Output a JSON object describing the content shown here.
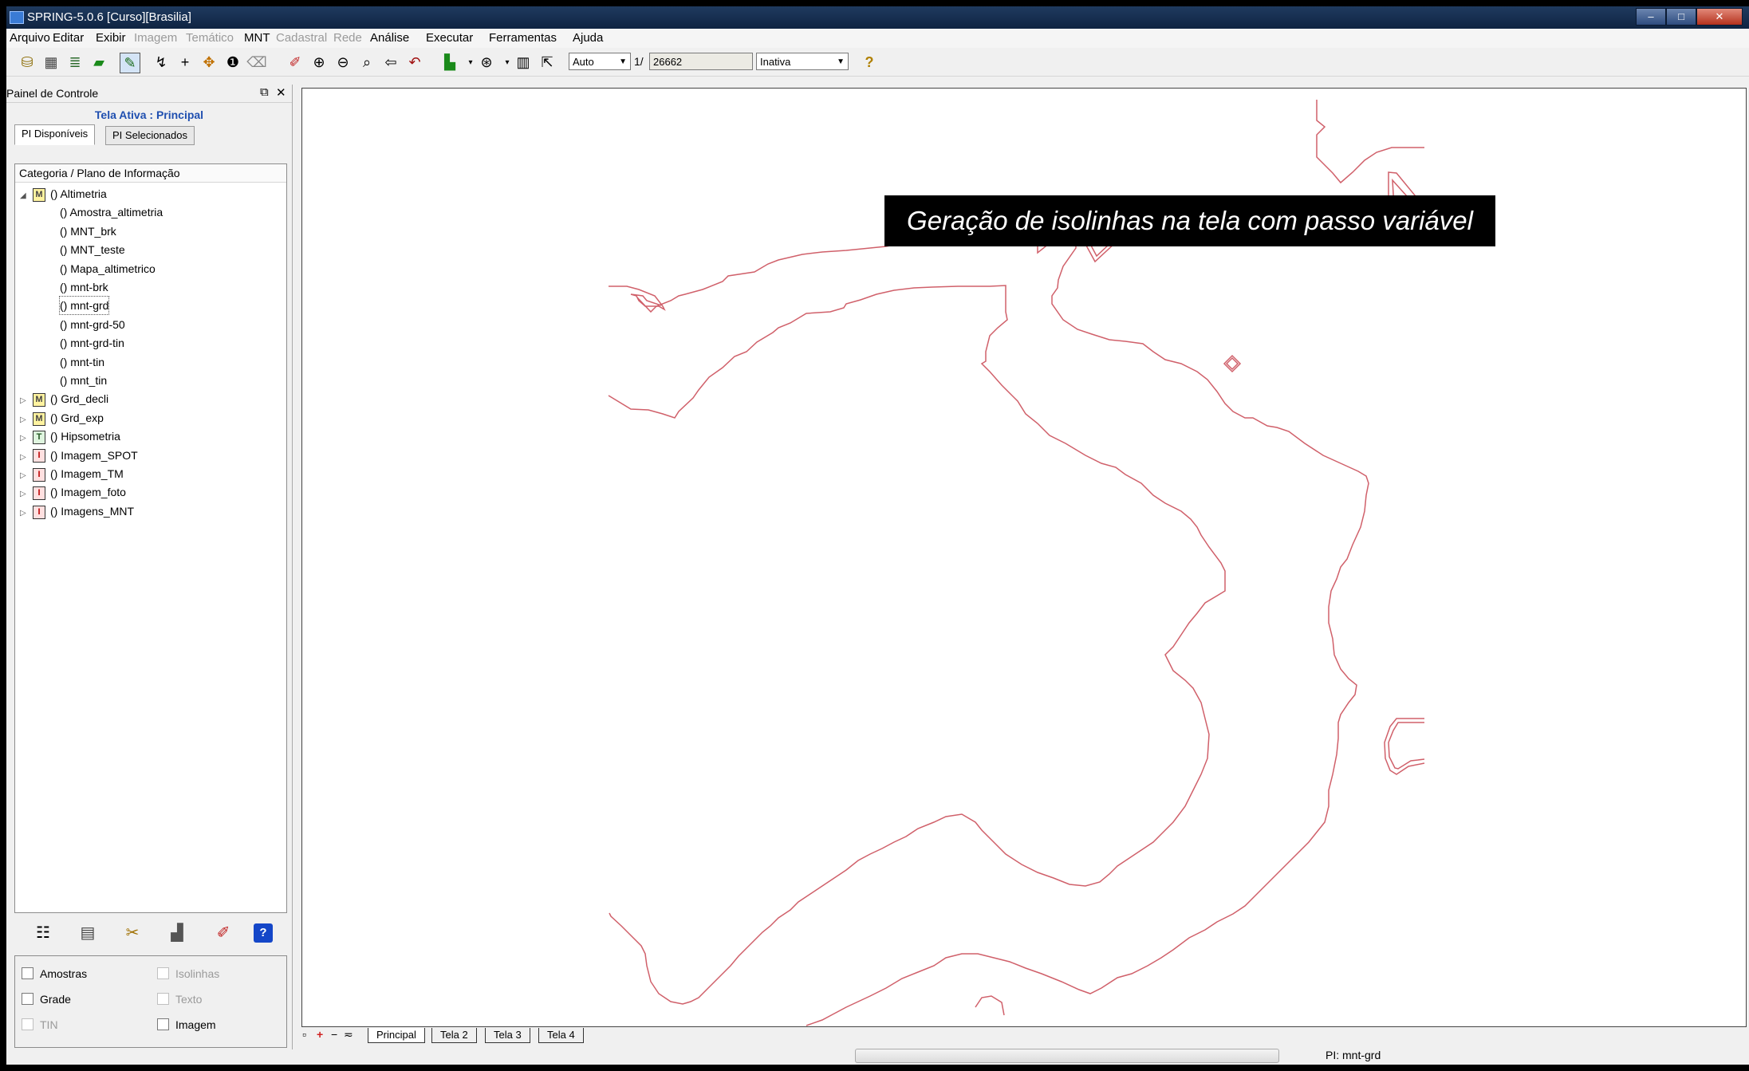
{
  "window": {
    "title": "SPRING-5.0.6 [Curso][Brasilia]",
    "controls": {
      "minimize": "–",
      "maximize": "□",
      "close": "✕"
    }
  },
  "menu": [
    {
      "label": "Arquivo",
      "enabled": true
    },
    {
      "label": "Editar",
      "enabled": true
    },
    {
      "label": "Exibir",
      "enabled": true
    },
    {
      "label": "Imagem",
      "enabled": false
    },
    {
      "label": "Temático",
      "enabled": false
    },
    {
      "label": "MNT",
      "enabled": true
    },
    {
      "label": "Cadastral",
      "enabled": false
    },
    {
      "label": "Rede",
      "enabled": false
    },
    {
      "label": "Análise",
      "enabled": true
    },
    {
      "label": "Executar",
      "enabled": true
    },
    {
      "label": "Ferramentas",
      "enabled": true
    },
    {
      "label": "Ajuda",
      "enabled": true
    }
  ],
  "toolbar": {
    "scale_mode": "Auto",
    "scale_prefix": "1/",
    "scale_value": "26662",
    "edit_mode": "Inativa",
    "help_symbol": "?"
  },
  "panel": {
    "title": "Painel de Controle",
    "active_screen": "Tela Ativa : Principal",
    "tabs": [
      "PI Disponíveis",
      "PI Selecionados"
    ],
    "tree_header": "Categoria / Plano de Informação",
    "tree": [
      {
        "label": "() Altimetria",
        "badge": "M",
        "level": 0,
        "expander": "◢"
      },
      {
        "label": "() Amostra_altimetria",
        "level": 1
      },
      {
        "label": "() MNT_brk",
        "level": 1
      },
      {
        "label": "() MNT_teste",
        "level": 1
      },
      {
        "label": "() Mapa_altimetrico",
        "level": 1
      },
      {
        "label": "() mnt-brk",
        "level": 1
      },
      {
        "label": "() mnt-grd",
        "level": 1,
        "selected": true
      },
      {
        "label": "() mnt-grd-50",
        "level": 1
      },
      {
        "label": "() mnt-grd-tin",
        "level": 1
      },
      {
        "label": "() mnt-tin",
        "level": 1
      },
      {
        "label": "() mnt_tin",
        "level": 1
      },
      {
        "label": "() Grd_decli",
        "badge": "M",
        "level": 0,
        "expander": "▷"
      },
      {
        "label": "() Grd_exp",
        "badge": "M",
        "level": 0,
        "expander": "▷"
      },
      {
        "label": "() Hipsometria",
        "badge": "T",
        "level": 0,
        "expander": "▷"
      },
      {
        "label": "() Imagem_SPOT",
        "badge": "I",
        "level": 0,
        "expander": "▷"
      },
      {
        "label": "() Imagem_TM",
        "badge": "I",
        "level": 0,
        "expander": "▷"
      },
      {
        "label": "() Imagem_foto",
        "badge": "I",
        "level": 0,
        "expander": "▷"
      },
      {
        "label": "() Imagens_MNT",
        "badge": "I",
        "level": 0,
        "expander": "▷"
      }
    ],
    "checkboxes": [
      {
        "label": "Amostras",
        "enabled": true
      },
      {
        "label": "Isolinhas",
        "enabled": false
      },
      {
        "label": "Grade",
        "enabled": true
      },
      {
        "label": "Texto",
        "enabled": false
      },
      {
        "label": "TIN",
        "enabled": false
      },
      {
        "label": "Imagem",
        "enabled": true
      }
    ]
  },
  "canvas": {
    "caption": "Geração de isolinhas na tela com passo variável",
    "line_color": "#d0606a"
  },
  "sheet_tabs": [
    "Principal",
    "Tela 2",
    "Tela 3",
    "Tela 4"
  ],
  "status": {
    "pi": "PI: mnt-grd"
  }
}
